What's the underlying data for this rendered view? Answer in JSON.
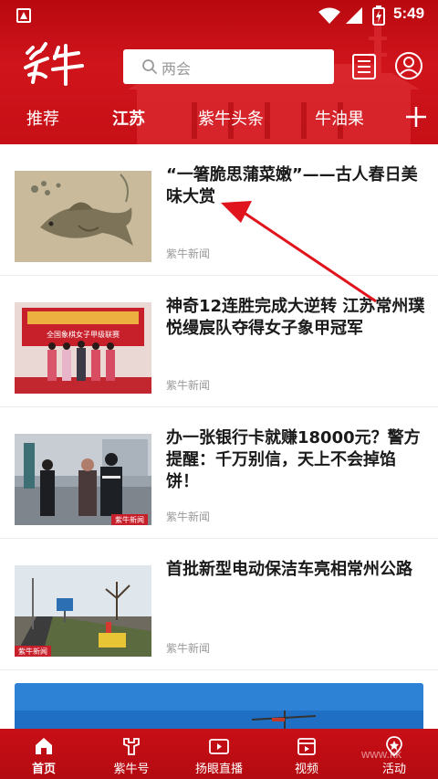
{
  "status_bar": {
    "time": "5:49"
  },
  "header": {
    "logo_text": "紫牛",
    "search_placeholder": "两会",
    "channels": [
      {
        "label": "推荐",
        "active": false
      },
      {
        "label": "江苏",
        "active": true
      },
      {
        "label": "紫牛头条",
        "active": false
      },
      {
        "label": "牛油果",
        "active": false
      }
    ],
    "add_channel_icon": "plus-icon"
  },
  "news": [
    {
      "title": "“一箸脆思蒲菜嫩”——古人春日美味大赏",
      "source": "紫牛新闻"
    },
    {
      "title": "神奇12连胜完成大逆转 江苏常州璞悦缦宸队夺得女子象甲冠军",
      "source": "紫牛新闻",
      "thumb_caption": "全国象棋女子甲级联赛"
    },
    {
      "title": "办一张银行卡就赚18000元？警方提醒：千万别信，天上不会掉馅饼！",
      "source": "紫牛新闻",
      "thumb_badge": "紫牛新闻"
    },
    {
      "title": "首批新型电动保洁车亮相常州公路",
      "source": "紫牛新闻",
      "thumb_badge": "紫牛新闻"
    }
  ],
  "bottom_nav": [
    {
      "label": "首页",
      "icon": "home-icon",
      "active": true
    },
    {
      "label": "紫牛号",
      "icon": "ziniu-hao-icon",
      "active": false
    },
    {
      "label": "扬眼直播",
      "icon": "live-icon",
      "active": false
    },
    {
      "label": "视频",
      "icon": "video-icon",
      "active": false
    },
    {
      "label": "活动",
      "icon": "activity-icon",
      "active": false
    }
  ],
  "watermark": "www.kk"
}
